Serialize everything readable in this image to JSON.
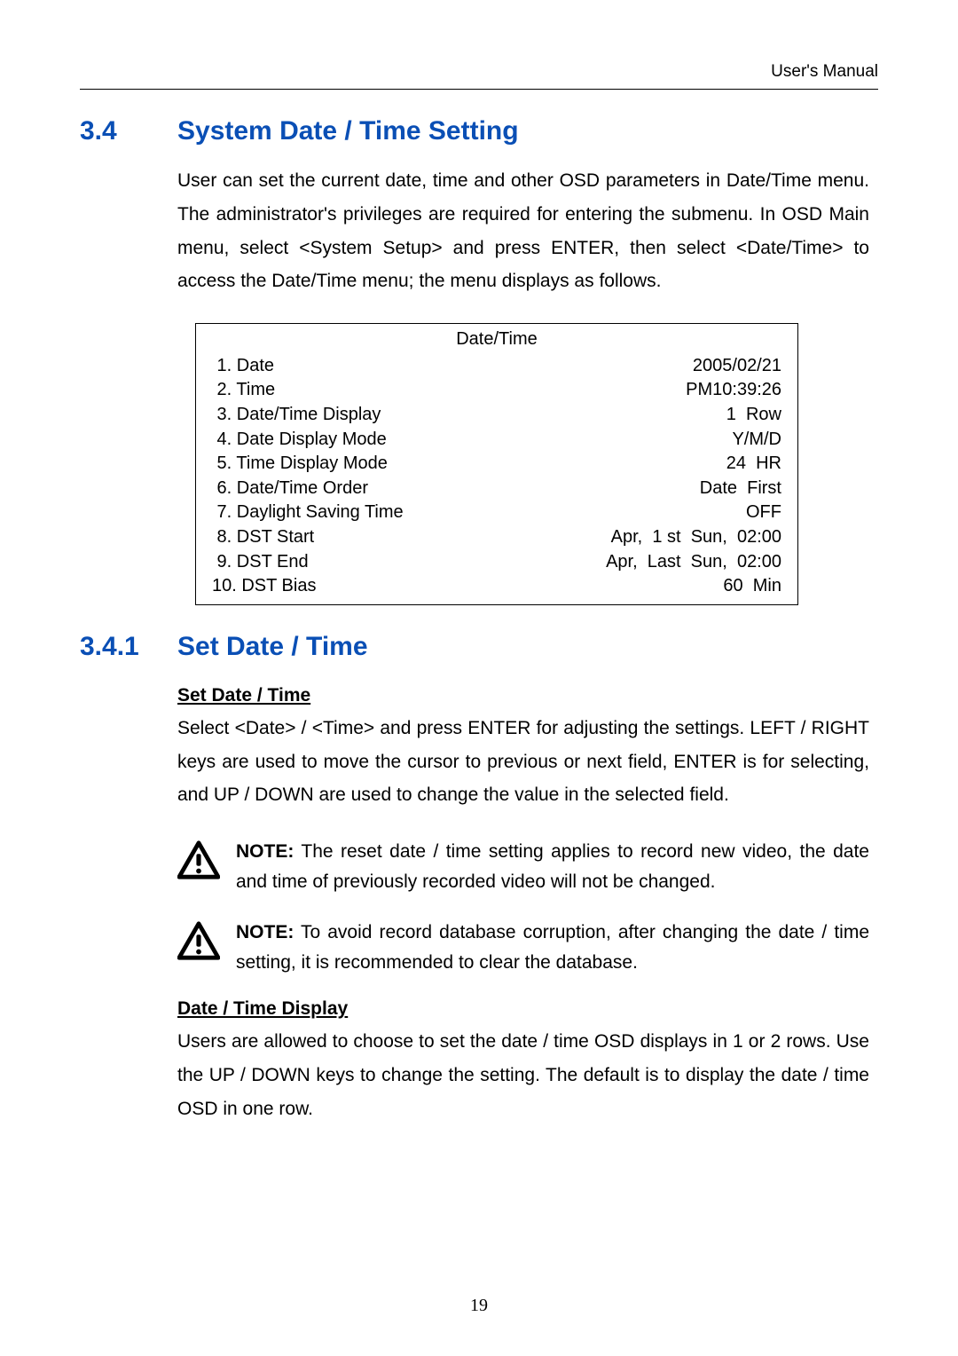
{
  "header": {
    "right": "User's Manual"
  },
  "section34": {
    "number": "3.4",
    "title": "System Date / Time Setting",
    "paragraph": "User can set the current date, time and other OSD parameters in Date/Time menu. The administrator's privileges are required for entering the submenu. In OSD Main menu, select <System Setup> and press ENTER, then select <Date/Time> to access the Date/Time menu; the menu displays as follows."
  },
  "menu": {
    "title": "Date/Time",
    "rows": [
      {
        "label": " 1. Date",
        "value": "2005/02/21"
      },
      {
        "label": " 2. Time",
        "value": "PM10:39:26"
      },
      {
        "label": " 3. Date/Time Display",
        "value": "1  Row"
      },
      {
        "label": " 4. Date Display Mode",
        "value": "Y/M/D"
      },
      {
        "label": " 5. Time Display Mode",
        "value": "24  HR"
      },
      {
        "label": " 6. Date/Time Order",
        "value": "Date  First"
      },
      {
        "label": " 7. Daylight Saving Time",
        "value": "OFF"
      },
      {
        "label": " 8. DST Start",
        "value": "Apr,  1 st  Sun,  02:00"
      },
      {
        "label": " 9. DST End",
        "value": "Apr,  Last  Sun,  02:00"
      },
      {
        "label": "10. DST Bias",
        "value": "60  Min"
      }
    ]
  },
  "section341": {
    "number": "3.4.1",
    "title": "Set Date / Time"
  },
  "setDateTime": {
    "heading": "Set Date / Time",
    "paragraph": "Select <Date> / <Time> and press ENTER for adjusting the settings. LEFT / RIGHT keys are used to move the cursor to previous or next field, ENTER is for selecting, and UP / DOWN are used to change the value in the selected field."
  },
  "notes": {
    "note1_label": "NOTE:",
    "note1_body": " The reset date / time setting applies to record new video, the date and time of previously recorded video will not be changed.",
    "note2_label": "NOTE:",
    "note2_body": " To avoid record database corruption, after changing the date / time setting, it is recommended to clear the database."
  },
  "dateTimeDisplay": {
    "heading": "Date / Time Display",
    "paragraph": "Users are allowed to choose to set the date / time OSD displays in 1 or 2 rows. Use the UP / DOWN keys to change the setting. The default is to display the date / time OSD in one row."
  },
  "footer": {
    "page_number": "19"
  }
}
